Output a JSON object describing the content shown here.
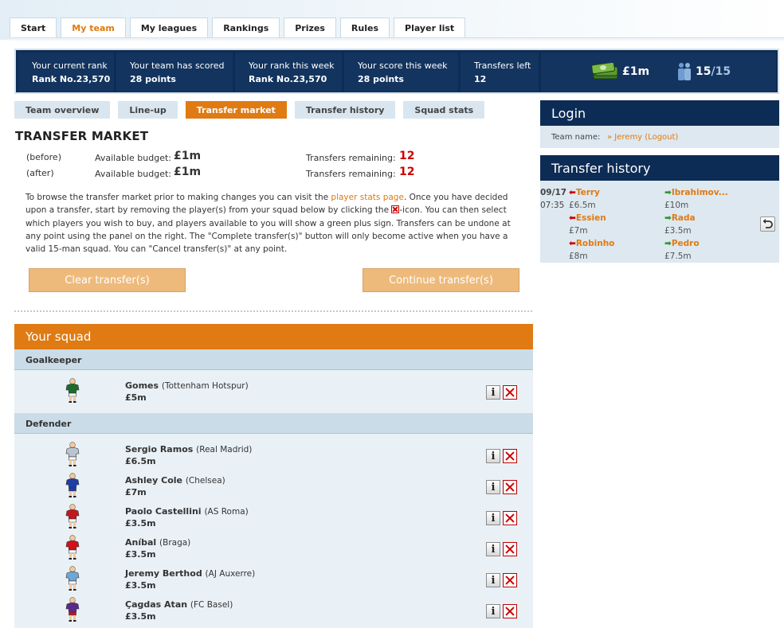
{
  "nav": {
    "tabs": [
      {
        "label": "Start"
      },
      {
        "label": "My team"
      },
      {
        "label": "My leagues"
      },
      {
        "label": "Rankings"
      },
      {
        "label": "Prizes"
      },
      {
        "label": "Rules"
      },
      {
        "label": "Player list"
      }
    ],
    "active_tab": "My team"
  },
  "stats": {
    "current_rank": {
      "label": "Your current rank",
      "value": "Rank No.23,570"
    },
    "team_scored": {
      "label": "Your team has scored",
      "value": "28 points"
    },
    "rank_week": {
      "label": "Your rank this week",
      "value": "Rank No.23,570"
    },
    "score_week": {
      "label": "Your score this week",
      "value": "28 points"
    },
    "transfers_left": {
      "label": "Transfers left",
      "value": "12"
    },
    "budget": "£1m",
    "squad_count": "15",
    "squad_total": "/15"
  },
  "subnav": {
    "tabs": [
      {
        "label": "Team overview"
      },
      {
        "label": "Line-up"
      },
      {
        "label": "Transfer market"
      },
      {
        "label": "Transfer history"
      },
      {
        "label": "Squad stats"
      }
    ],
    "active_tab": "Transfer market"
  },
  "market": {
    "title": "TRANSFER MARKET",
    "before": {
      "tag": "(before)",
      "budget_label": "Available budget:",
      "budget": "£1m",
      "transfers_label": "Transfers remaining:",
      "transfers": "12"
    },
    "after": {
      "tag": "(after)",
      "budget_label": "Available budget:",
      "budget": "£1m",
      "transfers_label": "Transfers remaining:",
      "transfers": "12"
    },
    "intro_1": "To browse the transfer market prior to making changes you can visit the ",
    "intro_link": "player stats page",
    "intro_2": ". Once you have decided upon a transfer, start by removing the player(s) from your squad below by clicking the ",
    "intro_3": "-icon. You can then select which players you wish to buy, and players available to you will show a green plus sign. Transfers can be undone at any point using the panel on the right. The \"Complete transfer(s)\" button will only become active when you have a valid 15-man squad. You can \"Cancel transfer(s)\" at any point.",
    "clear_label": "Clear transfer(s)",
    "continue_label": "Continue transfer(s)"
  },
  "squad": {
    "title": "Your squad",
    "goalkeeper_label": "Goalkeeper",
    "defender_label": "Defender",
    "goalkeepers": [
      {
        "name": "Gomes",
        "club": "(Tottenham Hotspur)",
        "price": "£5m",
        "kit": "#1e6b2a",
        "shorts": "#ffffff"
      }
    ],
    "defenders": [
      {
        "name": "Sergio Ramos",
        "club": "(Real Madrid)",
        "price": "£6.5m",
        "kit": "#b8c4d0",
        "shorts": "#ffffff"
      },
      {
        "name": "Ashley Cole",
        "club": "(Chelsea)",
        "price": "£7m",
        "kit": "#1e3fa8",
        "shorts": "#1e3fa8"
      },
      {
        "name": "Paolo Castellini",
        "club": "(AS Roma)",
        "price": "£3.5m",
        "kit": "#c0181e",
        "shorts": "#ffffff"
      },
      {
        "name": "Aníbal",
        "club": "(Braga)",
        "price": "£3.5m",
        "kit": "#d0101a",
        "shorts": "#ffffff"
      },
      {
        "name": "Jeremy Berthod",
        "club": "(AJ Auxerre)",
        "price": "£3.5m",
        "kit": "#6ea6d8",
        "shorts": "#ffffff"
      },
      {
        "name": "Çagdas Atan",
        "club": "(FC Basel)",
        "price": "£3.5m",
        "kit": "#5a2a8a",
        "shorts": "#c0181e"
      }
    ]
  },
  "login": {
    "title": "Login",
    "team_label": "Team name:",
    "user": "» Jeremy (Logout)"
  },
  "history": {
    "title": "Transfer history",
    "date": "09/17",
    "time": "07:35",
    "out": [
      {
        "name": "Terry",
        "price": "£6.5m"
      },
      {
        "name": "Essien",
        "price": "£7m"
      },
      {
        "name": "Robinho",
        "price": "£8m"
      }
    ],
    "in": [
      {
        "name": "Ibrahimov...",
        "price": "£10m"
      },
      {
        "name": "Rada",
        "price": "£3.5m"
      },
      {
        "name": "Pedro",
        "price": "£7.5m"
      }
    ]
  },
  "icons": {
    "out_arrow": "⬅",
    "in_arrow": "➡",
    "info": "i"
  }
}
